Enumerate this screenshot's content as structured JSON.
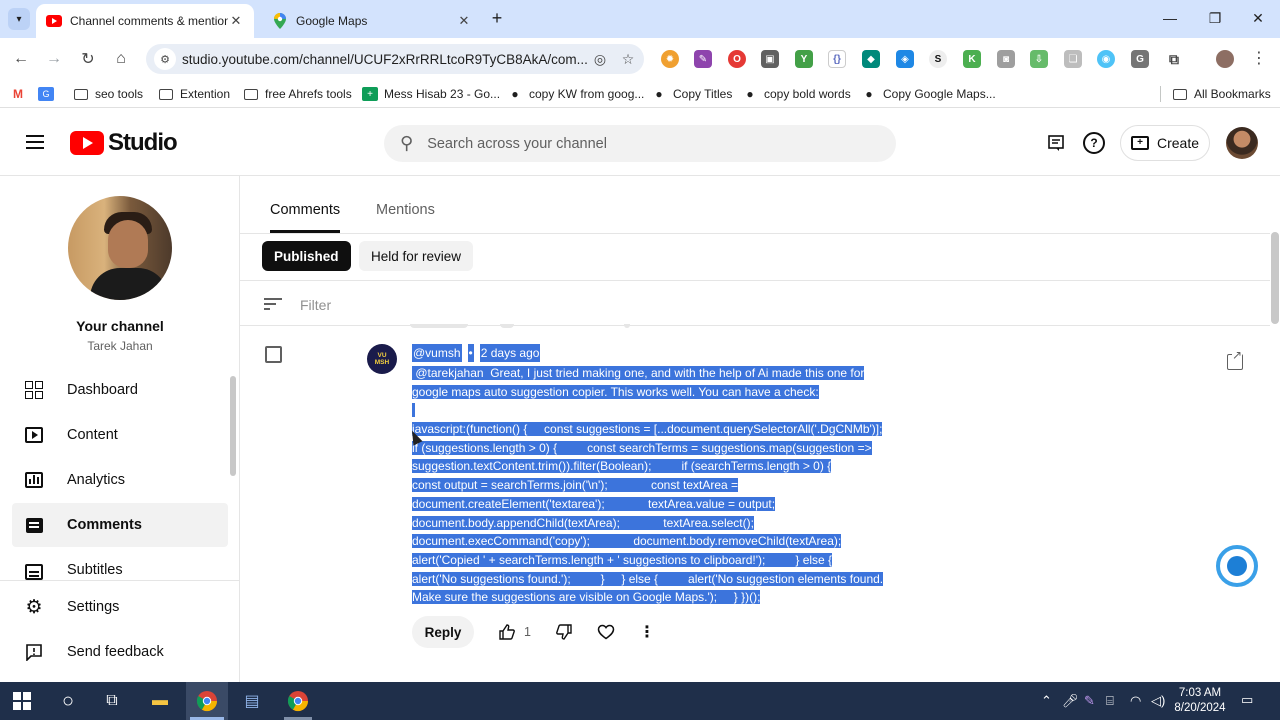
{
  "browser": {
    "tabs": [
      {
        "title": "Channel comments & mentions",
        "active": true
      },
      {
        "title": "Google Maps",
        "active": false
      }
    ],
    "url": "studio.youtube.com/channel/UCUF2xRrRRLtcoR9TyCB8AkA/com...",
    "bookmarks": [
      {
        "label": "seo tools",
        "icon": "folder-icon"
      },
      {
        "label": "Extention",
        "icon": "folder-icon"
      },
      {
        "label": "free Ahrefs tools",
        "icon": "folder-icon"
      },
      {
        "label": "Mess Hisab 23 - Go...",
        "icon": "sheets-icon"
      },
      {
        "label": "copy KW from goog...",
        "icon": "github-icon"
      },
      {
        "label": "Copy Titles",
        "icon": "github-icon"
      },
      {
        "label": "copy bold words",
        "icon": "github-icon"
      },
      {
        "label": "Copy Google Maps...",
        "icon": "github-icon"
      }
    ],
    "all_bookmarks": "All Bookmarks"
  },
  "studio": {
    "logo_text": "Studio",
    "search_placeholder": "Search across your channel",
    "create_label": "Create"
  },
  "sidebar": {
    "channel_title": "Your channel",
    "channel_name": "Tarek Jahan",
    "items": [
      {
        "label": "Dashboard",
        "icon": "dashboard-icon"
      },
      {
        "label": "Content",
        "icon": "content-icon"
      },
      {
        "label": "Analytics",
        "icon": "analytics-icon"
      },
      {
        "label": "Comments",
        "icon": "comments-icon",
        "active": true
      },
      {
        "label": "Subtitles",
        "icon": "subtitles-icon"
      }
    ],
    "bottom_items": [
      {
        "label": "Settings",
        "icon": "gear-icon"
      },
      {
        "label": "Send feedback",
        "icon": "feedback-icon"
      }
    ]
  },
  "main": {
    "tabs": [
      {
        "label": "Comments",
        "active": true
      },
      {
        "label": "Mentions",
        "active": false
      }
    ],
    "chips": [
      {
        "label": "Published",
        "active": true
      },
      {
        "label": "Held for review",
        "active": false
      }
    ],
    "filter_placeholder": "Filter",
    "comment": {
      "avatar_line1": "VU",
      "avatar_line2": "MSH",
      "author": "@vumsh",
      "separator": "•",
      "time": "2 days ago",
      "lines": [
        " @tarekjahan  Great, I just tried making one, and with the help of Ai made this one for",
        "google maps auto suggestion copier. This works well. You can have a check:",
        " ",
        "javascript:(function() {     const suggestions = [...document.querySelectorAll('.DgCNMb')];",
        "if (suggestions.length > 0) {         const searchTerms = suggestions.map(suggestion =>",
        "suggestion.textContent.trim()).filter(Boolean);         if (searchTerms.length > 0) {",
        "const output = searchTerms.join('\\n');             const textArea =",
        "document.createElement('textarea');             textArea.value = output;",
        "document.body.appendChild(textArea);             textArea.select();",
        "document.execCommand('copy');             document.body.removeChild(textArea);",
        "alert('Copied ' + searchTerms.length + ' suggestions to clipboard!');         } else {",
        "alert('No suggestions found.');         }     } else {         alert('No suggestion elements found.",
        "Make sure the suggestions are visible on Google Maps.');     } })();"
      ],
      "reply_label": "Reply",
      "like_count": "1"
    }
  },
  "taskbar": {
    "time": "7:03 AM",
    "date": "8/20/2024"
  },
  "colors": {
    "selection": "#3c74dc",
    "youtube_red": "#ff0000",
    "chrome_tabstrip": "#d3e3fd",
    "taskbar": "#1f2f4a"
  }
}
